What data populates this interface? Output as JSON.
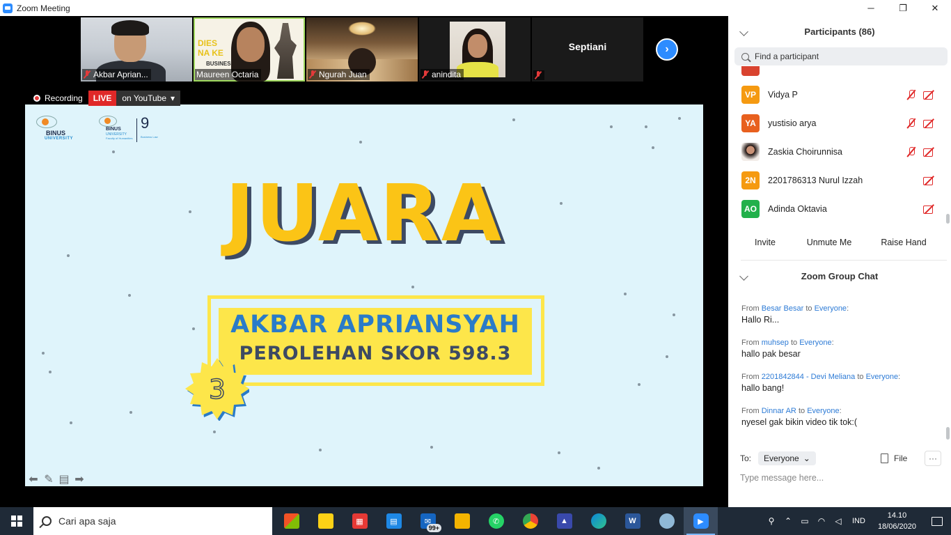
{
  "window": {
    "title": "Zoom Meeting",
    "minimize": "─",
    "restore": "❐",
    "close": "✕"
  },
  "thumbnails": [
    {
      "name": "Akbar Aprian..."
    },
    {
      "name": "Maureen Octaria",
      "banner": "DIES NA KE",
      "banner_sub": "BUSINESS"
    },
    {
      "name": "Ngurah Juan"
    },
    {
      "name": "anindita"
    },
    {
      "name": "Septiani"
    }
  ],
  "recording": {
    "label": "Recording",
    "live": "LIVE",
    "stream": "on YouTube"
  },
  "slide": {
    "logo1_title": "BINUS",
    "logo1_sub": "UNIVERSITY",
    "logo2_title": "BINUS",
    "logo2_sub": "UNIVERSITY",
    "logo2_faculty": "Faculty of Humanities",
    "logo2_num": "9",
    "logo2_dept": "Business Law",
    "heading": "JUARA",
    "winner": "AKBAR APRIANSYAH",
    "score": "PEROLEHAN SKOR 598.3",
    "rank": "3"
  },
  "participants": {
    "header": "Participants (86)",
    "search_placeholder": "Find a participant",
    "list": [
      {
        "initials": "VP",
        "name": "Vidya P",
        "color": "#f59a11",
        "mic_muted": true
      },
      {
        "initials": "YA",
        "name": "yustisio arya",
        "color": "#e8601e",
        "mic_muted": true
      },
      {
        "initials": "",
        "name": "Zaskia Choirunnisa",
        "color": "#7a3b2a",
        "mic_muted": true
      },
      {
        "initials": "2N",
        "name": "2201786313 Nurul Izzah",
        "color": "#f59a11",
        "mic_muted": false
      },
      {
        "initials": "AO",
        "name": "Adinda Oktavia",
        "color": "#22b04b",
        "mic_muted": false
      }
    ],
    "actions": {
      "invite": "Invite",
      "unmute": "Unmute Me",
      "raise_hand": "Raise Hand"
    }
  },
  "chat": {
    "header": "Zoom Group Chat",
    "messages": [
      {
        "from": "Besar Besar",
        "to": "Everyone",
        "text": "Hallo Ri..."
      },
      {
        "from": "muhsep",
        "to": "Everyone",
        "text": "hallo pak besar"
      },
      {
        "from": "2201842844 - Devi Meliana",
        "to": "Everyone",
        "text": "hallo bang!"
      },
      {
        "from": "Dinnar AR",
        "to": "Everyone",
        "text": "nyesel gak bikin video tik tok:("
      }
    ],
    "from_word": "From",
    "to_word": "to",
    "to_label": "To:",
    "recipient": "Everyone",
    "file": "File",
    "more": "···",
    "input_placeholder": "Type message here..."
  },
  "taskbar": {
    "search_placeholder": "Cari apa saja",
    "mail_badge": "99+",
    "lang": "IND",
    "time": "14.10",
    "date": "18/06/2020"
  }
}
